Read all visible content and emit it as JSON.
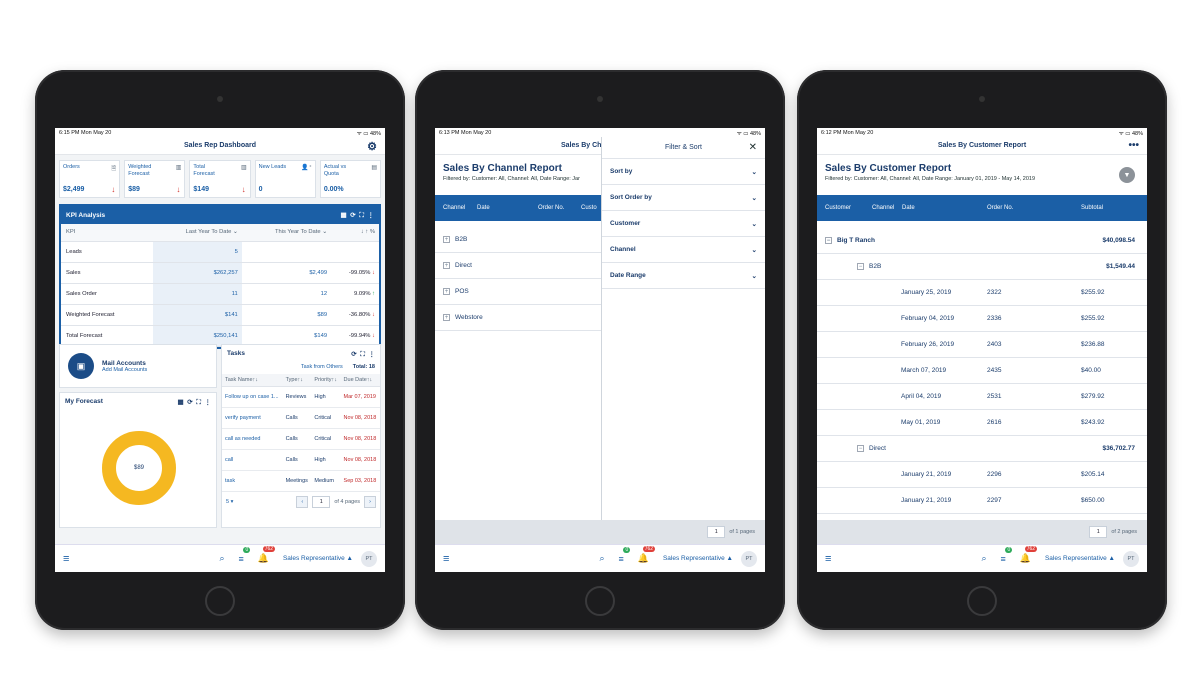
{
  "status": {
    "time1": "6:15 PM   Mon May 20",
    "time2": "6:13 PM   Mon May 20",
    "time3": "6:12 PM   Mon May 20",
    "battery": "48%"
  },
  "bottom": {
    "role": "Sales Representative ▲",
    "avatar": "PT",
    "badge_green": "0",
    "badge_red": "762"
  },
  "dashboard": {
    "title": "Sales Rep Dashboard",
    "tiles": [
      {
        "label": "Orders",
        "value": "$2,499",
        "arrow": "↓"
      },
      {
        "label": "Weighted Forecast",
        "value": "$89",
        "arrow": "↓"
      },
      {
        "label": "Total Forecast",
        "value": "$149",
        "arrow": "↓"
      },
      {
        "label": "New Leads",
        "value": "0",
        "arrow": ""
      },
      {
        "label": "Actual vs Quota",
        "value": "0.00%",
        "arrow": ""
      }
    ],
    "kpi": {
      "title": "KPI Analysis",
      "headers": [
        "KPI",
        "Last Year To Date ⌄",
        "This Year To Date ⌄",
        "↓ ↑ %"
      ],
      "rows": [
        {
          "name": "Leads",
          "last": "5",
          "this": "",
          "pct": "",
          "dir": ""
        },
        {
          "name": "Sales",
          "last": "$262,257",
          "this": "$2,499",
          "pct": "-99.05%",
          "dir": "↓"
        },
        {
          "name": "Sales Order",
          "last": "11",
          "this": "12",
          "pct": "9.09%",
          "dir": "↑"
        },
        {
          "name": "Weighted Forecast",
          "last": "$141",
          "this": "$89",
          "pct": "-36.80%",
          "dir": "↓"
        },
        {
          "name": "Total Forecast",
          "last": "$250,141",
          "this": "$149",
          "pct": "-99.94%",
          "dir": "↓"
        }
      ]
    },
    "mail": {
      "title": "Mail Accounts",
      "link": "Add Mail Accounts"
    },
    "forecast": {
      "title": "My Forecast",
      "center": "$89"
    },
    "tasks": {
      "title": "Tasks",
      "from_others": "Task from Others",
      "total": "Total: 18",
      "headers": [
        "Task Name↑↓",
        "Type↑↓",
        "Priority↑↓",
        "Due Date↑↓"
      ],
      "rows": [
        {
          "name": "Follow up on case 1...",
          "type": "Reviews",
          "priority": "High",
          "due": "Mar 07, 2019"
        },
        {
          "name": "verify payment",
          "type": "Calls",
          "priority": "Critical",
          "due": "Nov 08, 2018"
        },
        {
          "name": "call as needed",
          "type": "Calls",
          "priority": "Critical",
          "due": "Nov 08, 2018"
        },
        {
          "name": "call",
          "type": "Calls",
          "priority": "High",
          "due": "Nov 08, 2018"
        },
        {
          "name": "task",
          "type": "Meetings",
          "priority": "Medium",
          "due": "Sep 03, 2018"
        }
      ],
      "page_size": "5 ▾",
      "page": "1",
      "of_pages": "of 4 pages"
    }
  },
  "channel": {
    "header_title": "Sales By Cha",
    "title": "Sales By Channel Report",
    "subtitle": "Filtered by: Customer:  All, Channel:  All, Date Range:  Jar",
    "columns": [
      "Channel",
      "Date",
      "Order No.",
      "Custo"
    ],
    "rows": [
      "B2B",
      "Direct",
      "POS",
      "Webstore"
    ],
    "page": "1",
    "of_pages": "of 1 pages",
    "filter": {
      "title": "Filter & Sort",
      "items": [
        "Sort by",
        "Sort Order by",
        "Customer",
        "Channel",
        "Date Range"
      ]
    }
  },
  "customer": {
    "header_title": "Sales By Customer Report",
    "title": "Sales By Customer Report",
    "subtitle": "Filtered by: Customer:  All, Channel:  All, Date Range:  January 01, 2019 - May 14, 2019",
    "columns": [
      "Customer",
      "Channel",
      "Date",
      "Order No.",
      "Subtotal"
    ],
    "group": {
      "name": "Big T Ranch",
      "total": "$40,098.54"
    },
    "sub1": {
      "name": "B2B",
      "total": "$1,549.44"
    },
    "rows1": [
      {
        "date": "January 25, 2019",
        "order": "2322",
        "subtotal": "$255.92"
      },
      {
        "date": "February 04, 2019",
        "order": "2336",
        "subtotal": "$255.92"
      },
      {
        "date": "February 26, 2019",
        "order": "2403",
        "subtotal": "$236.88"
      },
      {
        "date": "March 07, 2019",
        "order": "2435",
        "subtotal": "$40.00"
      },
      {
        "date": "April 04, 2019",
        "order": "2531",
        "subtotal": "$279.92"
      },
      {
        "date": "May 01, 2019",
        "order": "2616",
        "subtotal": "$243.92"
      }
    ],
    "sub2": {
      "name": "Direct",
      "total": "$36,702.77"
    },
    "rows2": [
      {
        "date": "January 21, 2019",
        "order": "2296",
        "subtotal": "$205.14"
      },
      {
        "date": "January 21, 2019",
        "order": "2297",
        "subtotal": "$650.00"
      }
    ],
    "page": "1",
    "of_pages": "of 2 pages"
  }
}
